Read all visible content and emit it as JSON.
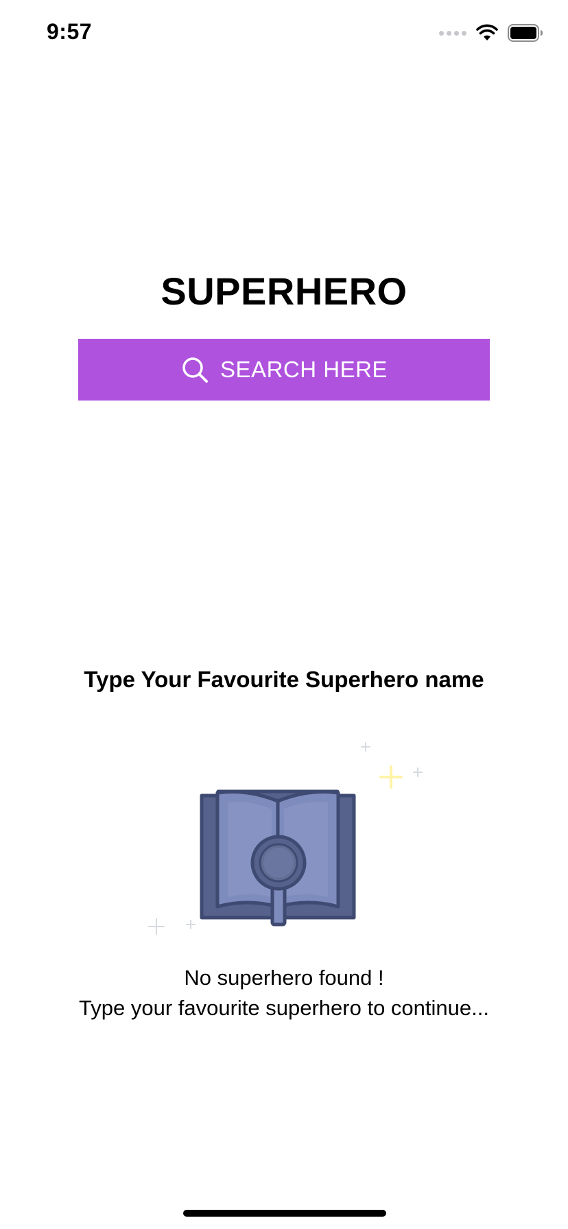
{
  "status_bar": {
    "time": "9:57",
    "icons": [
      "signal-icon",
      "wifi-icon",
      "battery-icon"
    ]
  },
  "header": {
    "title": "SUPERHERO"
  },
  "search": {
    "label": "SEARCH HERE",
    "icon": "search-icon"
  },
  "prompt": {
    "text": "Type Your Favourite Superhero name"
  },
  "empty_state": {
    "illustration": "book-magnifier-icon",
    "title": "No superhero found !",
    "subtitle": "Type your favourite superhero to continue..."
  },
  "colors": {
    "accent": "#af52de",
    "illustration_dark": "#3f4a72",
    "illustration_light": "#7e8bbd",
    "sparkle_yellow": "#fff3a8",
    "sparkle_gray": "#d7d9e0"
  }
}
